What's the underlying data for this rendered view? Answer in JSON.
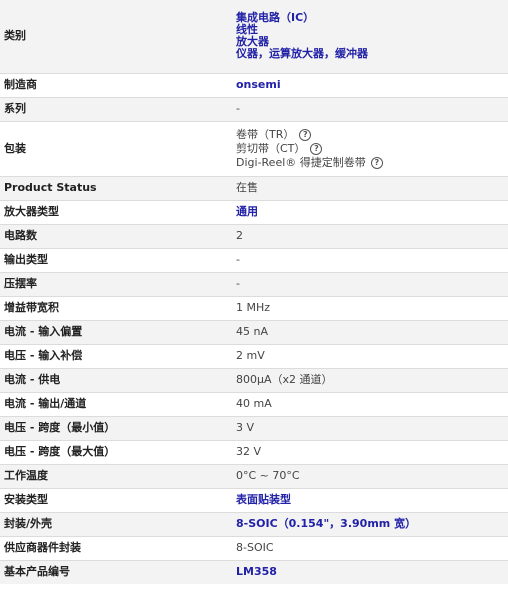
{
  "rows": [
    {
      "label": "类别",
      "links": [
        "集成电路（IC）",
        "线性",
        "放大器",
        "仪器，运算放大器，缓冲器"
      ]
    },
    {
      "label": "制造商",
      "links": [
        "onsemi"
      ]
    },
    {
      "label": "系列",
      "value": "-"
    },
    {
      "label": "包装",
      "packaging": [
        "卷带（TR）",
        "剪切带（CT）",
        "Digi-Reel® 得捷定制卷带"
      ],
      "icon": "question-circle-icon"
    },
    {
      "label": "Product Status",
      "value": "在售"
    },
    {
      "label": "放大器类型",
      "links": [
        "通用"
      ]
    },
    {
      "label": "电路数",
      "value": "2"
    },
    {
      "label": "输出类型",
      "value": "-"
    },
    {
      "label": "压摆率",
      "value": "-"
    },
    {
      "label": "增益带宽积",
      "value": "1 MHz"
    },
    {
      "label": "电流 - 输入偏置",
      "value": "45 nA"
    },
    {
      "label": "电压 - 输入补偿",
      "value": "2 mV"
    },
    {
      "label": "电流 - 供电",
      "value": "800µA（x2 通道）"
    },
    {
      "label": "电流 - 输出/通道",
      "value": "40 mA"
    },
    {
      "label": "电压 - 跨度（最小值）",
      "value": "3 V"
    },
    {
      "label": "电压 - 跨度（最大值）",
      "value": "32 V"
    },
    {
      "label": "工作温度",
      "value": "0°C ~ 70°C"
    },
    {
      "label": "安装类型",
      "links": [
        "表面贴装型"
      ]
    },
    {
      "label": "封装/外壳",
      "links": [
        "8-SOIC（0.154\"，3.90mm 宽）"
      ]
    },
    {
      "label": "供应商器件封装",
      "value": "8-SOIC"
    },
    {
      "label": "基本产品编号",
      "links": [
        "LM358"
      ]
    }
  ],
  "icon_glyph": "?"
}
